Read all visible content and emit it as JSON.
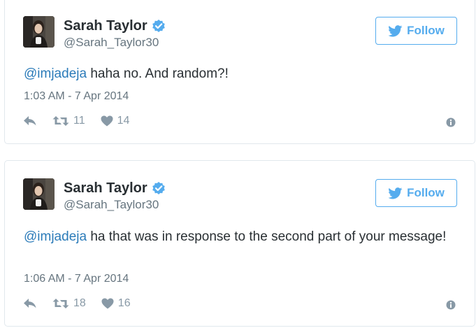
{
  "colors": {
    "link": "#2b7bb9",
    "follow_blue": "#55acee",
    "secondary_text": "#66757f",
    "action_gray": "#8899a6",
    "border": "#e1e8ed"
  },
  "icons": [
    "verified-badge-icon",
    "twitter-bird-icon",
    "reply-icon",
    "retweet-icon",
    "heart-icon",
    "info-icon"
  ],
  "tweets": [
    {
      "author": {
        "name": "Sarah Taylor",
        "handle": "@Sarah_Taylor30",
        "verified": true
      },
      "follow_label": "Follow",
      "mention": "@imjadeja",
      "text": " haha no. And random?!",
      "timestamp": "1:03 AM - 7 Apr 2014",
      "retweets": "11",
      "likes": "14"
    },
    {
      "author": {
        "name": "Sarah Taylor",
        "handle": "@Sarah_Taylor30",
        "verified": true
      },
      "follow_label": "Follow",
      "mention": "@imjadeja",
      "text": " ha that was in response to the second part of your message!",
      "timestamp": "1:06 AM - 7 Apr 2014",
      "retweets": "18",
      "likes": "16"
    }
  ]
}
